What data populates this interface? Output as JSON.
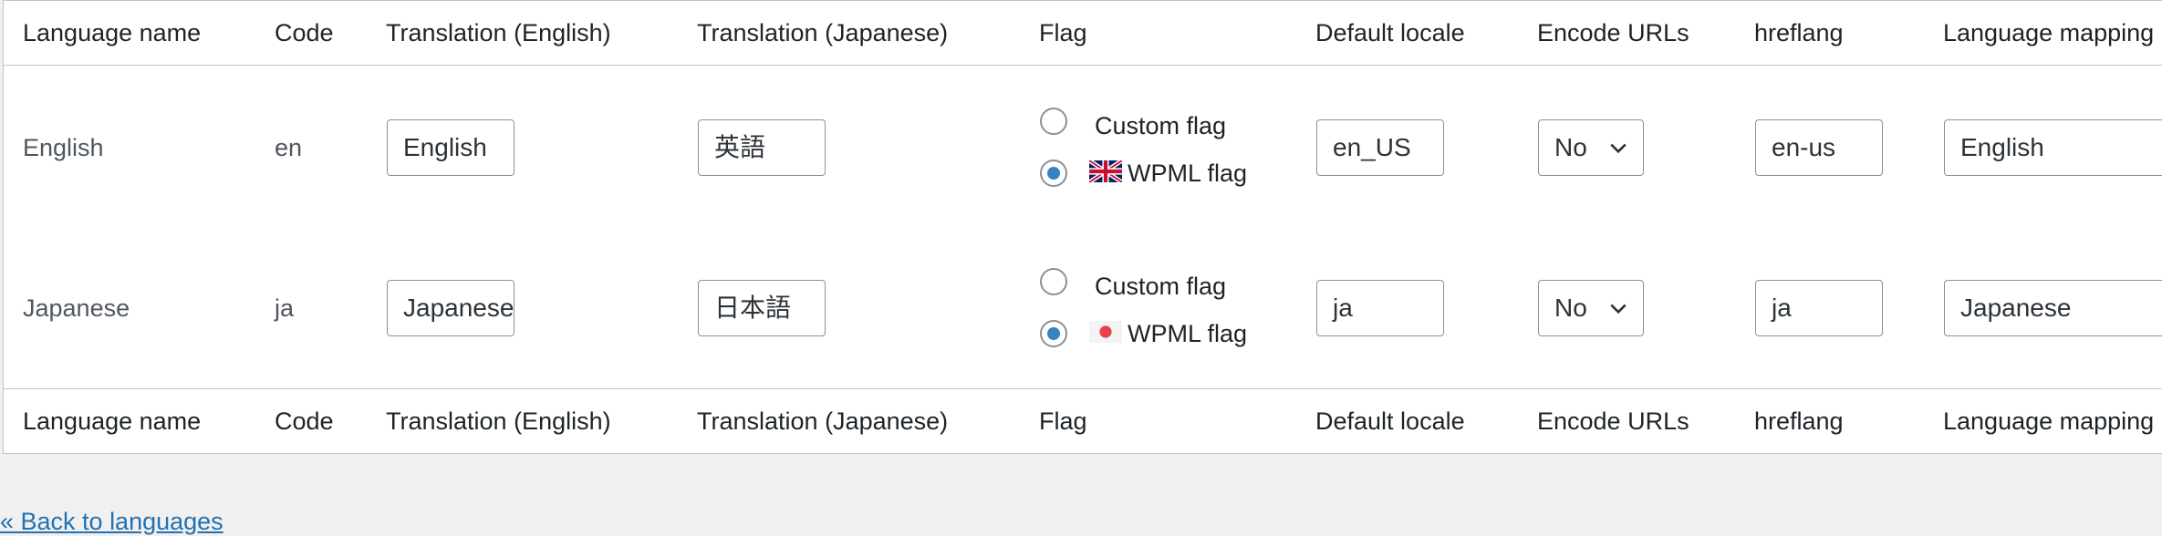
{
  "headers": [
    "Language name",
    "Code",
    "Translation (English)",
    "Translation (Japanese)",
    "Flag",
    "Default locale",
    "Encode URLs",
    "hreflang",
    "Language mapping"
  ],
  "flag_options": {
    "custom": "Custom flag",
    "wpml": "WPML flag"
  },
  "rows": [
    {
      "name": "English",
      "code": "en",
      "translation_en": "English",
      "translation_ja": "英語",
      "flag_selected": "wpml",
      "flag_icon": "uk-flag-icon",
      "default_locale": "en_US",
      "encode_urls": "No",
      "hreflang": "en-us",
      "mapping": "English"
    },
    {
      "name": "Japanese",
      "code": "ja",
      "translation_en": "Japanese",
      "translation_ja": "日本語",
      "flag_selected": "wpml",
      "flag_icon": "japan-flag-icon",
      "default_locale": "ja",
      "encode_urls": "No",
      "hreflang": "ja",
      "mapping": "Japanese"
    }
  ],
  "back_link": "« Back to languages",
  "colors": {
    "link": "#2271b1",
    "radio_checked": "#3582c4",
    "border": "#8c8f94"
  }
}
